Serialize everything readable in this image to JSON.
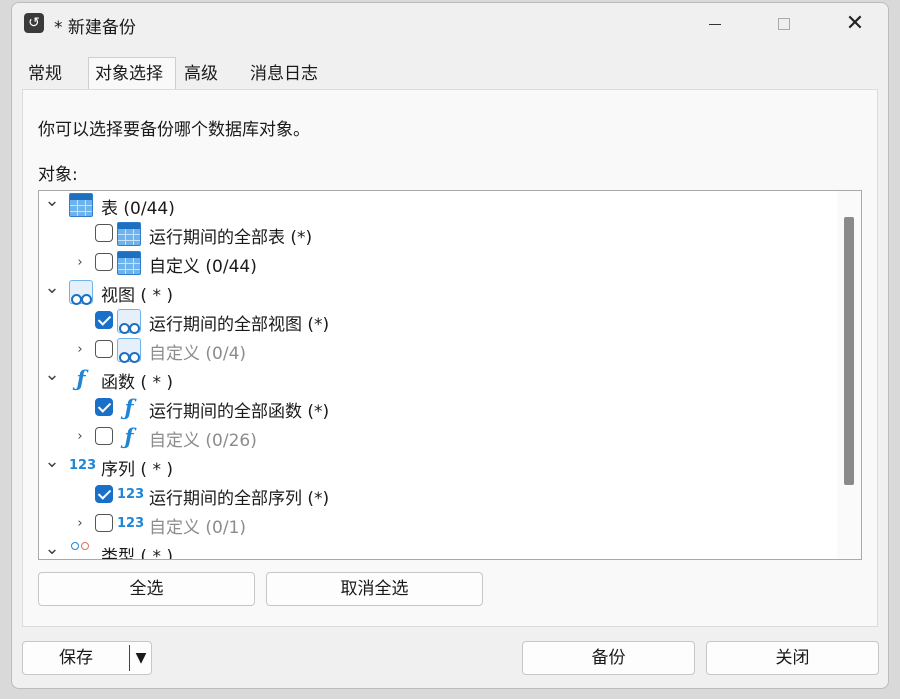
{
  "window": {
    "title": "* 新建备份",
    "app_icon": "backup-icon",
    "controls": {
      "minimize": "minimize-icon",
      "maximize": "maximize-icon",
      "close": "close-icon",
      "close_glyph": "✕"
    }
  },
  "tabs": [
    {
      "label": "常规",
      "active": false
    },
    {
      "label": "对象选择",
      "active": true
    },
    {
      "label": "高级",
      "active": false
    },
    {
      "label": "消息日志",
      "active": false
    }
  ],
  "panel": {
    "description": "你可以选择要备份哪个数据库对象。",
    "objects_label": "对象:"
  },
  "tree": [
    {
      "level": 0,
      "expander": "expanded",
      "icon": "table-icon",
      "label": "表 (0/44)",
      "checkbox": null,
      "dimmed": false
    },
    {
      "level": 1,
      "expander": "none",
      "icon": "table-icon",
      "label": "运行期间的全部表 (*)",
      "checkbox": false,
      "dimmed": false
    },
    {
      "level": 1,
      "expander": "collapsed",
      "icon": "table-icon",
      "label": "自定义 (0/44)",
      "checkbox": false,
      "dimmed": false
    },
    {
      "level": 0,
      "expander": "expanded",
      "icon": "view-icon",
      "label": "视图 ( * )",
      "checkbox": null,
      "dimmed": false
    },
    {
      "level": 1,
      "expander": "none",
      "icon": "view-icon",
      "label": "运行期间的全部视图 (*)",
      "checkbox": true,
      "dimmed": false
    },
    {
      "level": 1,
      "expander": "collapsed",
      "icon": "view-icon",
      "label": "自定义 (0/4)",
      "checkbox": false,
      "dimmed": true
    },
    {
      "level": 0,
      "expander": "expanded",
      "icon": "function-icon",
      "label": "函数 ( * )",
      "checkbox": null,
      "dimmed": false
    },
    {
      "level": 1,
      "expander": "none",
      "icon": "function-icon",
      "label": "运行期间的全部函数 (*)",
      "checkbox": true,
      "dimmed": false
    },
    {
      "level": 1,
      "expander": "collapsed",
      "icon": "function-icon",
      "label": "自定义 (0/26)",
      "checkbox": false,
      "dimmed": true
    },
    {
      "level": 0,
      "expander": "expanded",
      "icon": "sequence-icon",
      "label": "序列 ( * )",
      "checkbox": null,
      "dimmed": false
    },
    {
      "level": 1,
      "expander": "none",
      "icon": "sequence-icon",
      "label": "运行期间的全部序列 (*)",
      "checkbox": true,
      "dimmed": false
    },
    {
      "level": 1,
      "expander": "collapsed",
      "icon": "sequence-icon",
      "label": "自定义 (0/1)",
      "checkbox": false,
      "dimmed": true
    },
    {
      "level": 0,
      "expander": "expanded",
      "icon": "type-icon",
      "label": "类型 ( * )",
      "checkbox": null,
      "dimmed": false
    }
  ],
  "glyphs": {
    "expanded": "⌄",
    "collapsed": "›",
    "function": "ƒ",
    "sequence": "123",
    "dropdown": "▼"
  },
  "buttons": {
    "select_all": "全选",
    "deselect_all": "取消全选",
    "save": "保存",
    "backup": "备份",
    "close": "关闭"
  }
}
